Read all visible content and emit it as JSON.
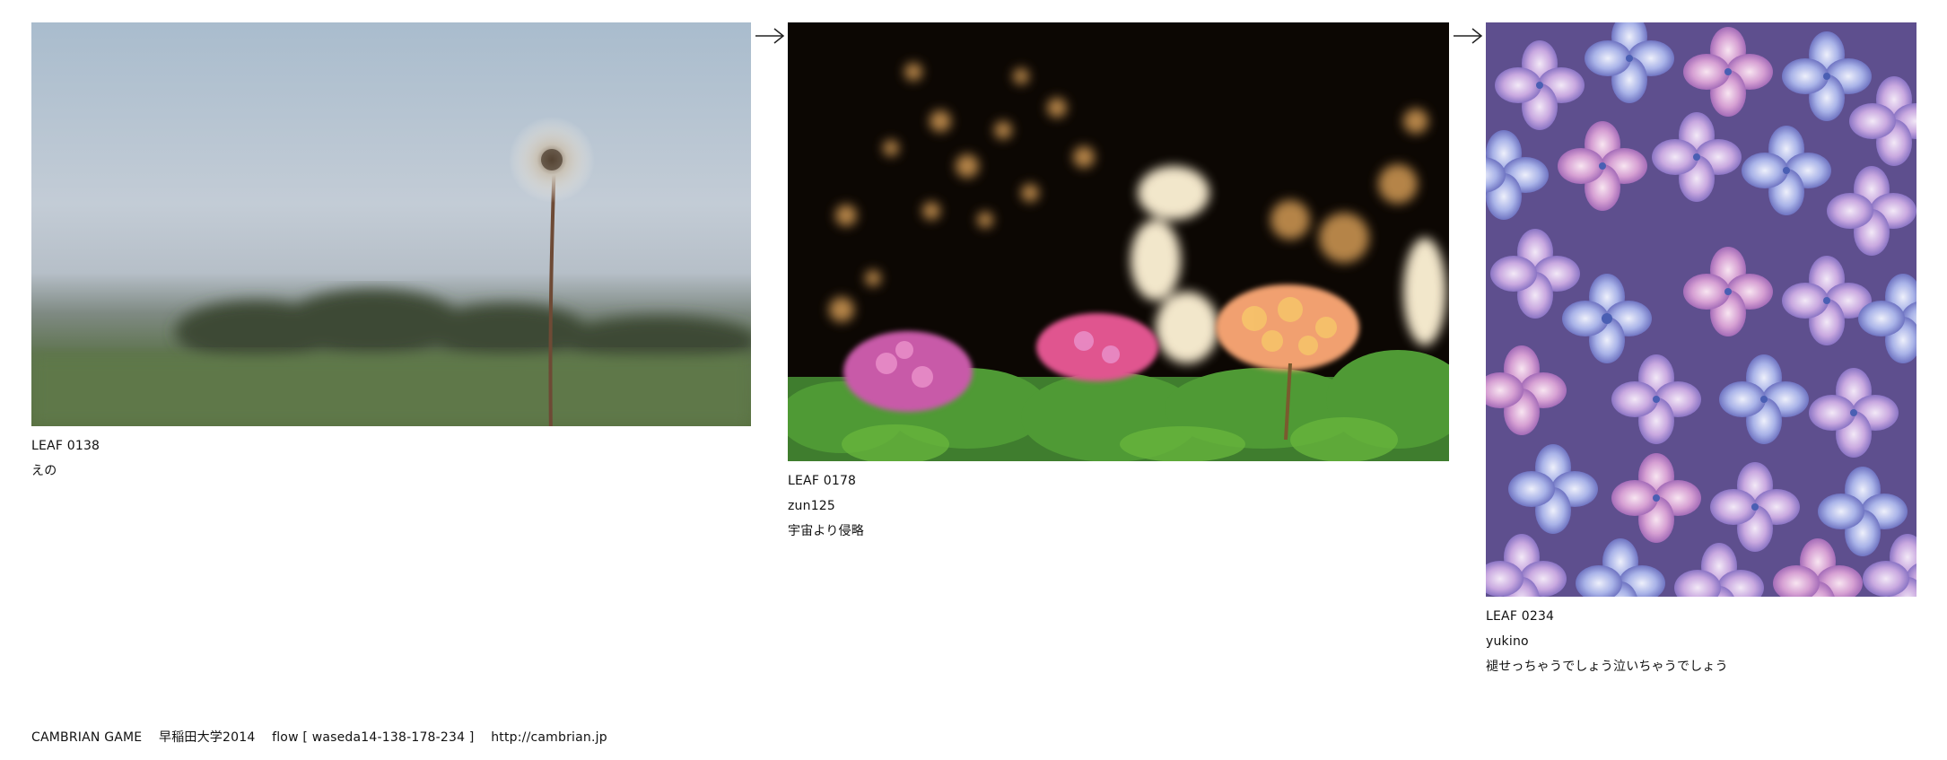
{
  "leaves": [
    {
      "id": "LEAF 0138",
      "author": "えの",
      "comment": ""
    },
    {
      "id": "LEAF 0178",
      "author": "zun125",
      "comment": "宇宙より侵略"
    },
    {
      "id": "LEAF 0234",
      "author": "yukino",
      "comment": "褪せっちゃうでしょう泣いちゃうでしょう"
    }
  ],
  "footer": {
    "game": "CAMBRIAN GAME",
    "event": "早稲田大学2014",
    "flow": "flow [ waseda14-138-178-234 ]",
    "url": "http://cambrian.jp"
  },
  "icons": {
    "arrow": "right-arrow-icon"
  },
  "colors": {
    "background": "#ffffff",
    "text": "#111111"
  }
}
